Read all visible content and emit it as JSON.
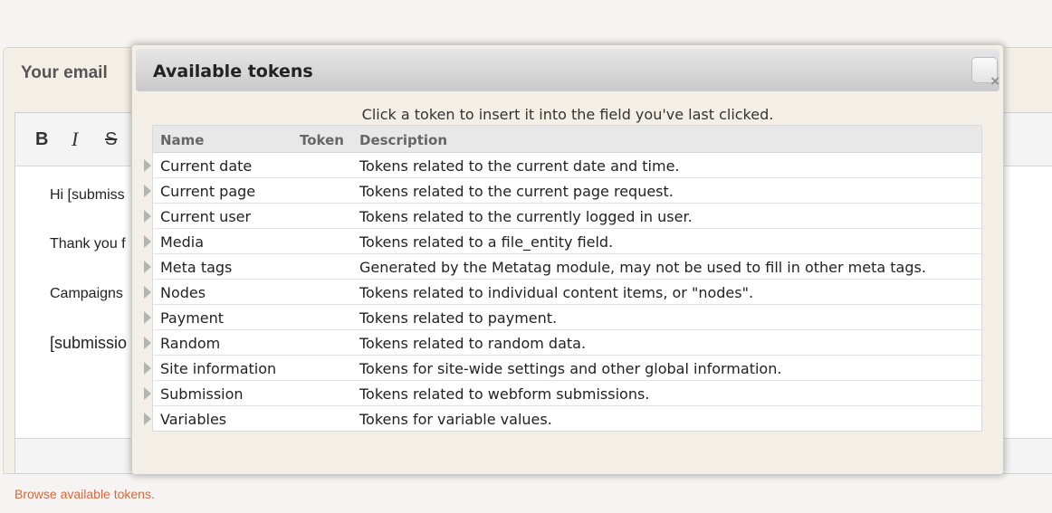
{
  "background": {
    "email_panel_title": "Your email",
    "toolbar": {
      "bold_label": "B",
      "italic_label": "I",
      "strike_label": "S"
    },
    "editor_lines": [
      "Hi [submiss",
      "Thank you f",
      "Campaigns",
      "[submissio"
    ],
    "browse_link_label": "Browse available tokens."
  },
  "dialog": {
    "title": "Available tokens",
    "close_label": "×",
    "instruction": "Click a token to insert it into the field you've last clicked.",
    "columns": {
      "name": "Name",
      "token": "Token",
      "description": "Description"
    },
    "rows": [
      {
        "name": "Current date",
        "description": "Tokens related to the current date and time."
      },
      {
        "name": "Current page",
        "description": "Tokens related to the current page request."
      },
      {
        "name": "Current user",
        "description": "Tokens related to the currently logged in user."
      },
      {
        "name": "Media",
        "description": "Tokens related to a file_entity field."
      },
      {
        "name": "Meta tags",
        "description": "Generated by the Metatag module, may not be used to fill in other meta tags."
      },
      {
        "name": "Nodes",
        "description": "Tokens related to individual content items, or \"nodes\"."
      },
      {
        "name": "Payment",
        "description": "Tokens related to payment."
      },
      {
        "name": "Random",
        "description": "Tokens related to random data."
      },
      {
        "name": "Site information",
        "description": "Tokens for site-wide settings and other global information."
      },
      {
        "name": "Submission",
        "description": "Tokens related to webform submissions."
      },
      {
        "name": "Variables",
        "description": "Tokens for variable values."
      }
    ]
  },
  "colors": {
    "link": "#e0643a",
    "panel_bg": "#f3efe6"
  }
}
